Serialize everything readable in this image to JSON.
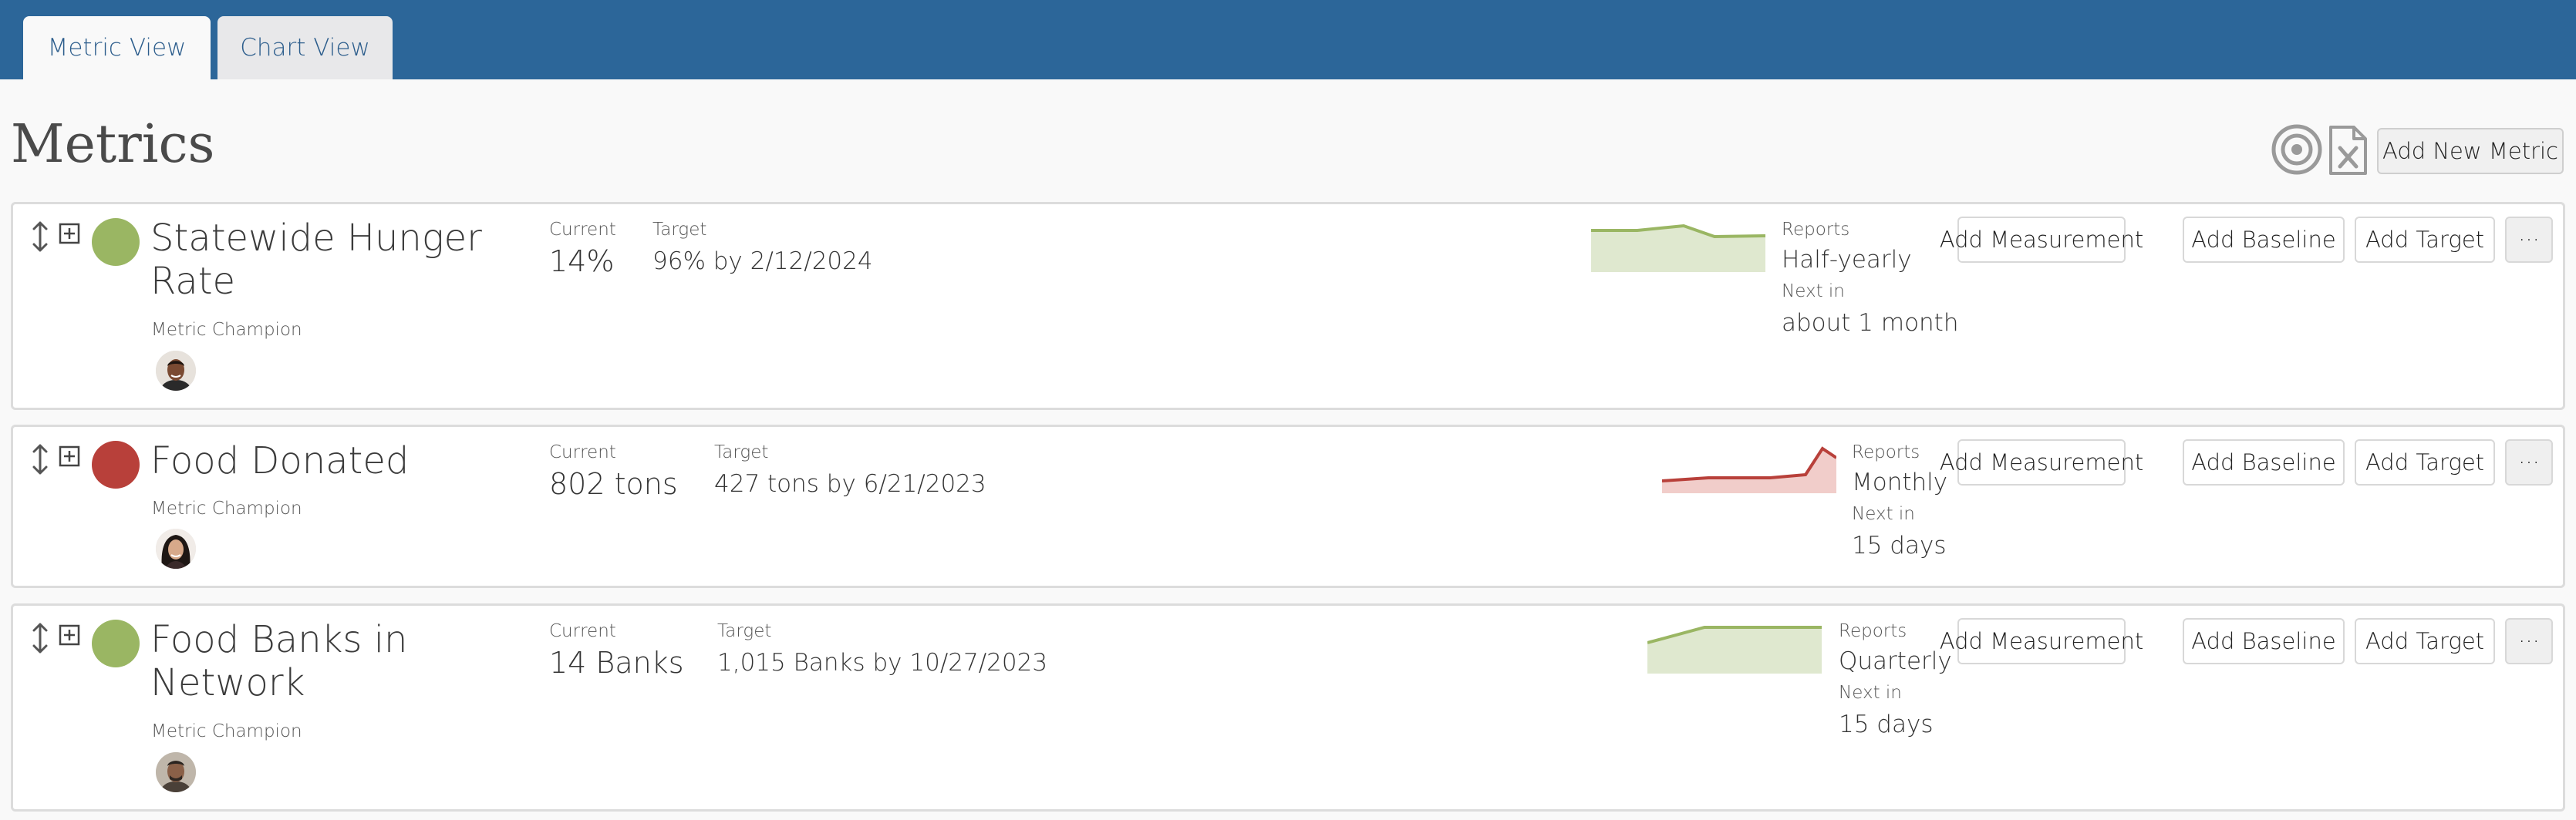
{
  "tabs": [
    {
      "label": "Metric View",
      "active": true
    },
    {
      "label": "Chart View",
      "active": false
    }
  ],
  "page": {
    "title": "Metrics",
    "add_new_metric_label": "Add New Metric"
  },
  "colors": {
    "brand": "#2c6699",
    "status_green": "#9ab663",
    "status_red": "#b8403a"
  },
  "labels": {
    "current": "Current",
    "target": "Target",
    "reports": "Reports",
    "next_in": "Next in",
    "metric_champion": "Metric Champion",
    "add_measurement": "Add Measurement",
    "add_baseline": "Add Baseline",
    "add_target": "Add Target",
    "more": "···"
  },
  "metrics": [
    {
      "name_line1": "Statewide Hunger",
      "name_line2": "Rate",
      "status": "green",
      "current": "14%",
      "target": "96% by 2/12/2024",
      "reports": "Half-yearly",
      "next_in": "about 1 month",
      "trend": "flat-up-down"
    },
    {
      "name_line1": "Food Donated",
      "name_line2": "",
      "status": "red",
      "current": "802 tons",
      "target": "427 tons by 6/21/2023",
      "reports": "Monthly",
      "next_in": "15 days",
      "trend": "spike-up"
    },
    {
      "name_line1": "Food Banks in",
      "name_line2": "Network",
      "status": "green",
      "current": "14 Banks",
      "target": "1,015 Banks by 10/27/2023",
      "reports": "Quarterly",
      "next_in": "15 days",
      "trend": "rise-then-flat"
    }
  ],
  "icons": [
    "sort-arrows-icon",
    "expand-plus-icon",
    "target-icon",
    "excel-export-icon"
  ]
}
